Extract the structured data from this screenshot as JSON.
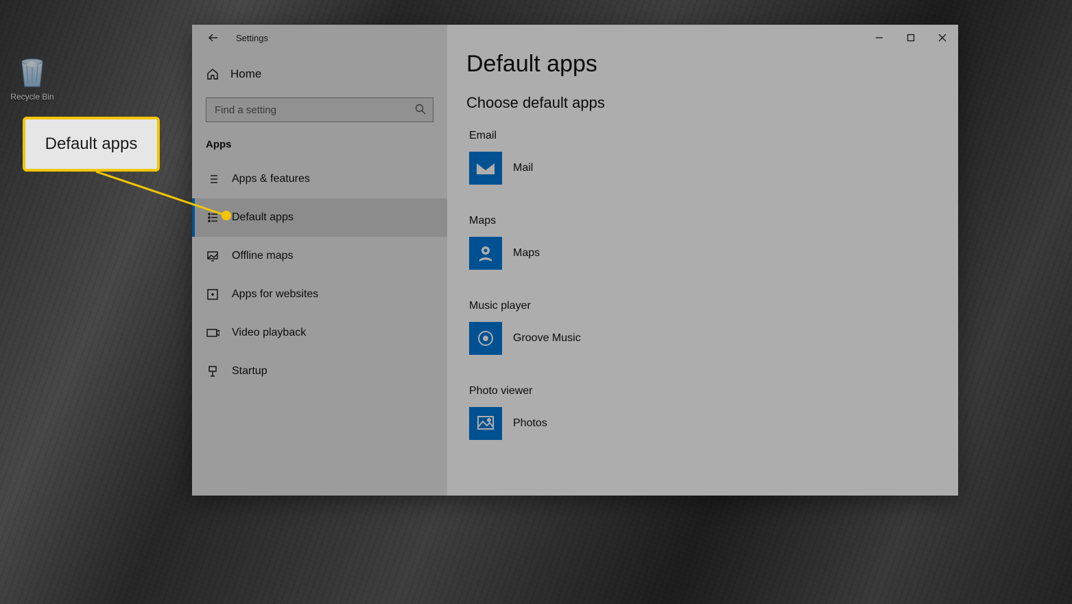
{
  "desktop": {
    "recycle_bin_label": "Recycle Bin"
  },
  "callout": {
    "text": "Default apps"
  },
  "window": {
    "title": "Settings",
    "home_label": "Home",
    "search_placeholder": "Find a setting",
    "section_label": "Apps",
    "nav": [
      {
        "label": "Apps & features"
      },
      {
        "label": "Default apps"
      },
      {
        "label": "Offline maps"
      },
      {
        "label": "Apps for websites"
      },
      {
        "label": "Video playback"
      },
      {
        "label": "Startup"
      }
    ],
    "selected_nav_index": 1
  },
  "page": {
    "title": "Default apps",
    "subhead": "Choose default apps",
    "categories": [
      {
        "label": "Email",
        "app": "Mail"
      },
      {
        "label": "Maps",
        "app": "Maps"
      },
      {
        "label": "Music player",
        "app": "Groove Music"
      },
      {
        "label": "Photo viewer",
        "app": "Photos"
      }
    ]
  }
}
